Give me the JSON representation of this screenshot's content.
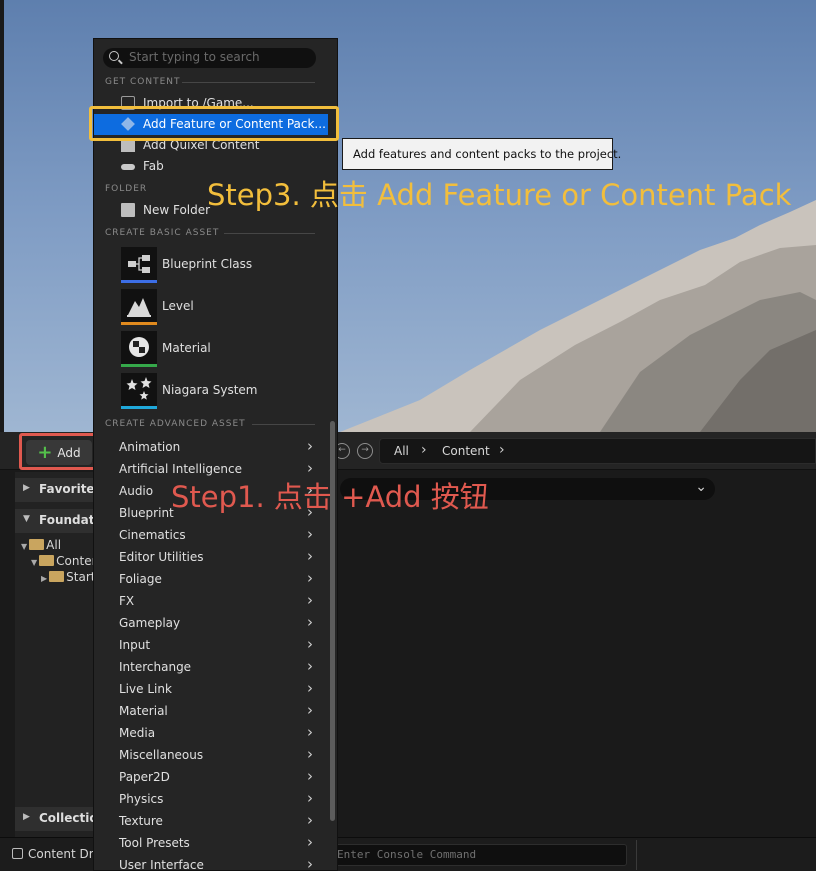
{
  "annotations": {
    "step3": "Step3. 点击 Add Feature or Content Pack",
    "step1": "Step1. 点击 +Add 按钮"
  },
  "tooltip": "Add features and content packs to the project.",
  "content_browser": {
    "add_label": "Add",
    "path": [
      "All",
      "Content"
    ],
    "sources": {
      "favorites": "Favorites",
      "foundation": "Foundation",
      "tree": [
        "All",
        "Content",
        "StarterContent"
      ],
      "collections": "Collections"
    }
  },
  "status_bar": {
    "content_drawer": "Content Drawer",
    "console_placeholder": "Enter Console Command"
  },
  "menu": {
    "search_placeholder": "Start typing to search",
    "get_content_header": "GET CONTENT",
    "get_content": [
      {
        "label": "Import to /Game...",
        "icon": "import-icon"
      },
      {
        "label": "Add Feature or Content Pack...",
        "icon": "content-pack-icon",
        "selected": true
      },
      {
        "label": "Add Quixel Content",
        "icon": "quixel-icon"
      },
      {
        "label": "Fab",
        "icon": "fab-icon"
      }
    ],
    "folder_header": "FOLDER",
    "new_folder": "New Folder",
    "basic_header": "CREATE BASIC ASSET",
    "basic_assets": [
      {
        "label": "Blueprint Class",
        "color": "#3c6ee6"
      },
      {
        "label": "Level",
        "color": "#e08a1e"
      },
      {
        "label": "Material",
        "color": "#35a84a"
      },
      {
        "label": "Niagara System",
        "color": "#1fa7d9"
      }
    ],
    "advanced_header": "CREATE ADVANCED ASSET",
    "advanced_assets": [
      "Animation",
      "Artificial Intelligence",
      "Audio",
      "Blueprint",
      "Cinematics",
      "Editor Utilities",
      "Foliage",
      "FX",
      "Gameplay",
      "Input",
      "Interchange",
      "Live Link",
      "Material",
      "Media",
      "Miscellaneous",
      "Paper2D",
      "Physics",
      "Texture",
      "Tool Presets",
      "User Interface"
    ]
  },
  "colors": {
    "highlight_step1": "#e0594f",
    "highlight_step3": "#f2be3c",
    "selection": "#0d6ce0"
  }
}
